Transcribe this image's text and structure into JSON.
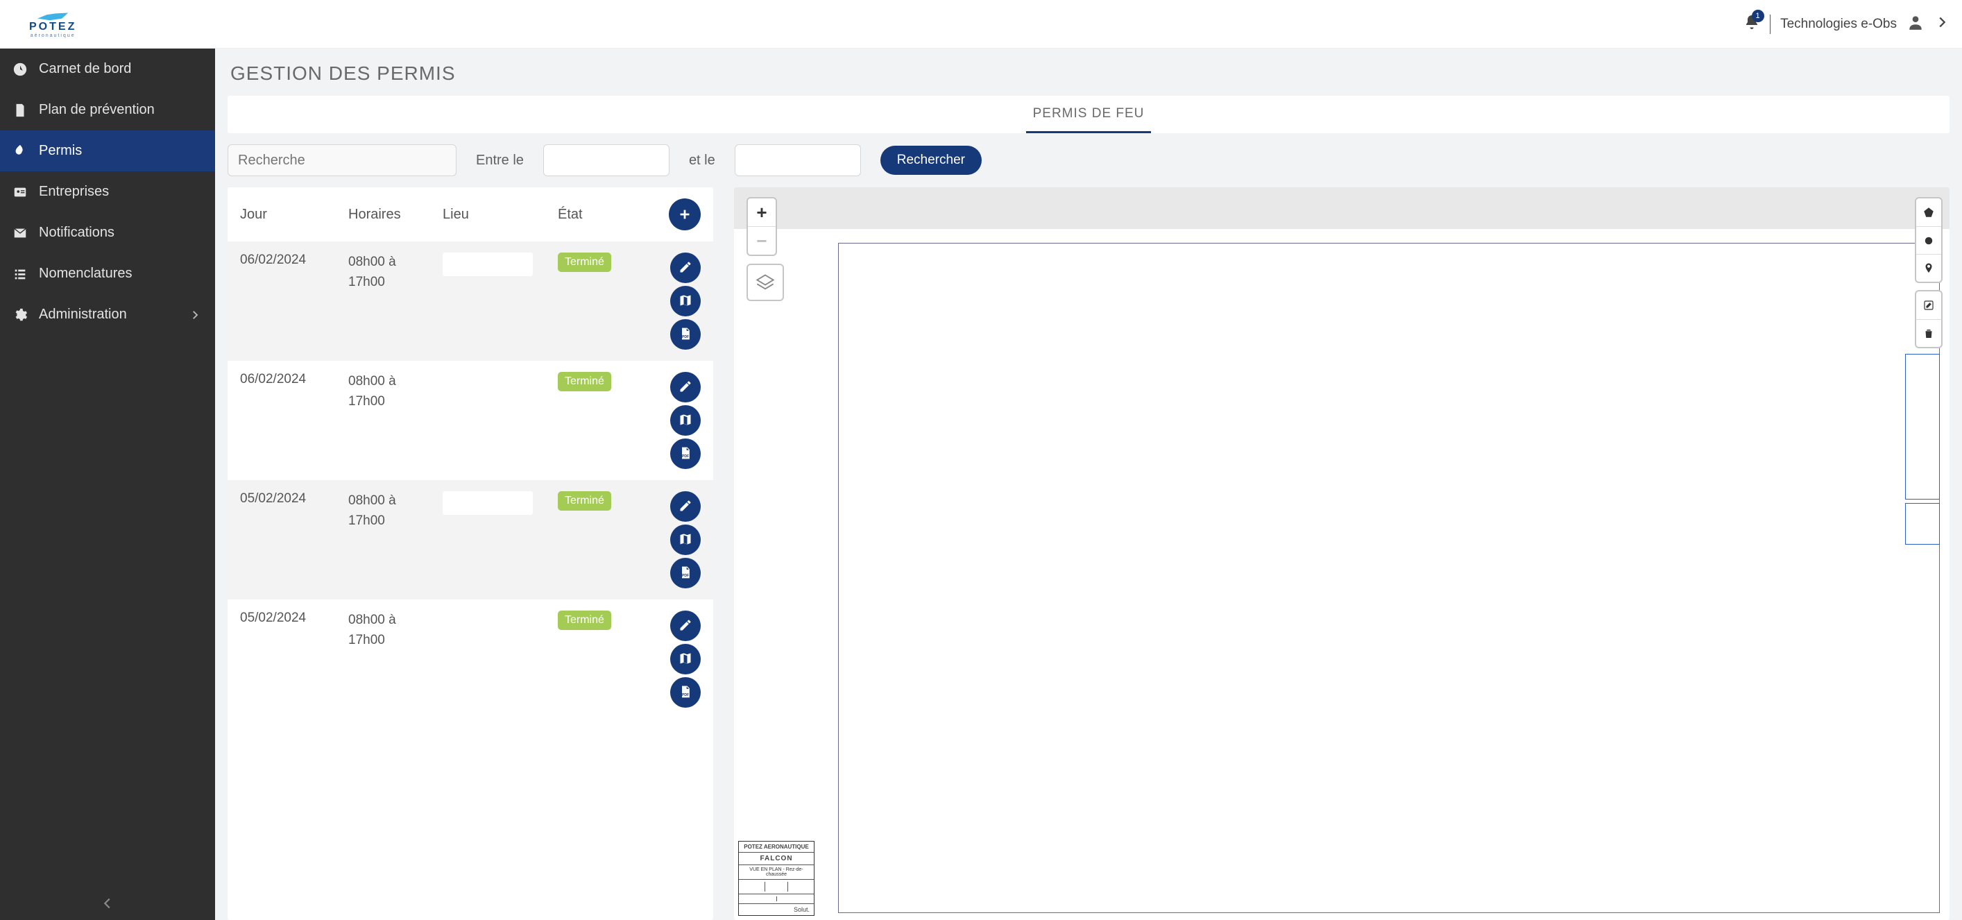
{
  "brand": {
    "name": "POTEZ",
    "tagline": "aéronautique"
  },
  "header": {
    "notifications_count": "1",
    "user": "Technologies e-Obs"
  },
  "sidebar": {
    "items": [
      {
        "label": "Carnet de bord"
      },
      {
        "label": "Plan de prévention"
      },
      {
        "label": "Permis"
      },
      {
        "label": "Entreprises"
      },
      {
        "label": "Notifications"
      },
      {
        "label": "Nomenclatures"
      },
      {
        "label": "Administration"
      }
    ],
    "active_index": 2
  },
  "page": {
    "title": "GESTION DES PERMIS",
    "tab": "PERMIS DE FEU",
    "search_placeholder": "Recherche",
    "label_between": "Entre le",
    "label_and": "et le",
    "search_button": "Rechercher"
  },
  "table": {
    "headers": {
      "day": "Jour",
      "hours": "Horaires",
      "place": "Lieu",
      "state": "État"
    },
    "rows": [
      {
        "date": "06/02/2024",
        "hours": "08h00 à 17h00",
        "state": "Terminé",
        "has_lieu_box": true
      },
      {
        "date": "06/02/2024",
        "hours": "08h00 à 17h00",
        "state": "Terminé",
        "has_lieu_box": false
      },
      {
        "date": "05/02/2024",
        "hours": "08h00 à 17h00",
        "state": "Terminé",
        "has_lieu_box": true
      },
      {
        "date": "05/02/2024",
        "hours": "08h00 à 17h00",
        "state": "Terminé",
        "has_lieu_box": false
      }
    ]
  },
  "map": {
    "legend": {
      "company": "POTEZ AERONAUTIQUE",
      "project": "FALCON",
      "view": "VUE EN PLAN - Rez-de-chaussée",
      "footer": "Solut."
    }
  }
}
